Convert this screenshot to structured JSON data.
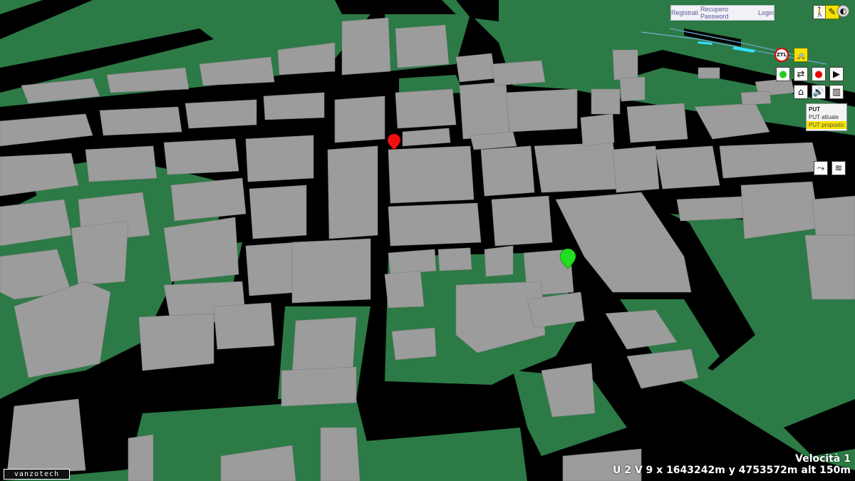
{
  "auth": {
    "register": "Registrati",
    "recover": "Recupero Password",
    "login": "Login"
  },
  "toolbar": {
    "pedestrian_icon": "pedestrian-icon",
    "mode_icon": "tools-icon",
    "globe_icon": "globe-icon",
    "ztl_icon": "ztl-sign-icon",
    "taxi_icon": "taxi-icon",
    "start_marker_icon": "green-marker-icon",
    "swap_icon": "swap-icon",
    "end_marker_icon": "red-marker-icon",
    "play_icon": "play-icon",
    "home_icon": "home-icon",
    "sound_icon": "speaker-icon",
    "chart_icon": "bar-chart-icon",
    "route_icon": "route-icon",
    "layers_icon": "layers-icon"
  },
  "put_menu": {
    "title": "PUT",
    "current": "PUT attuale",
    "proposed": "PUT proposto"
  },
  "status": {
    "speed": "Velocità 1",
    "position": "U 2 V 9 x 1643242m y 4753572m alt 150m"
  },
  "logo": "vanzotech",
  "colors": {
    "ground": "#2c7a45",
    "road": "#000000",
    "building": "#9a9a9a",
    "highlight": "#f4e200",
    "start_marker": "#22dd22",
    "end_marker": "#ee1111"
  }
}
